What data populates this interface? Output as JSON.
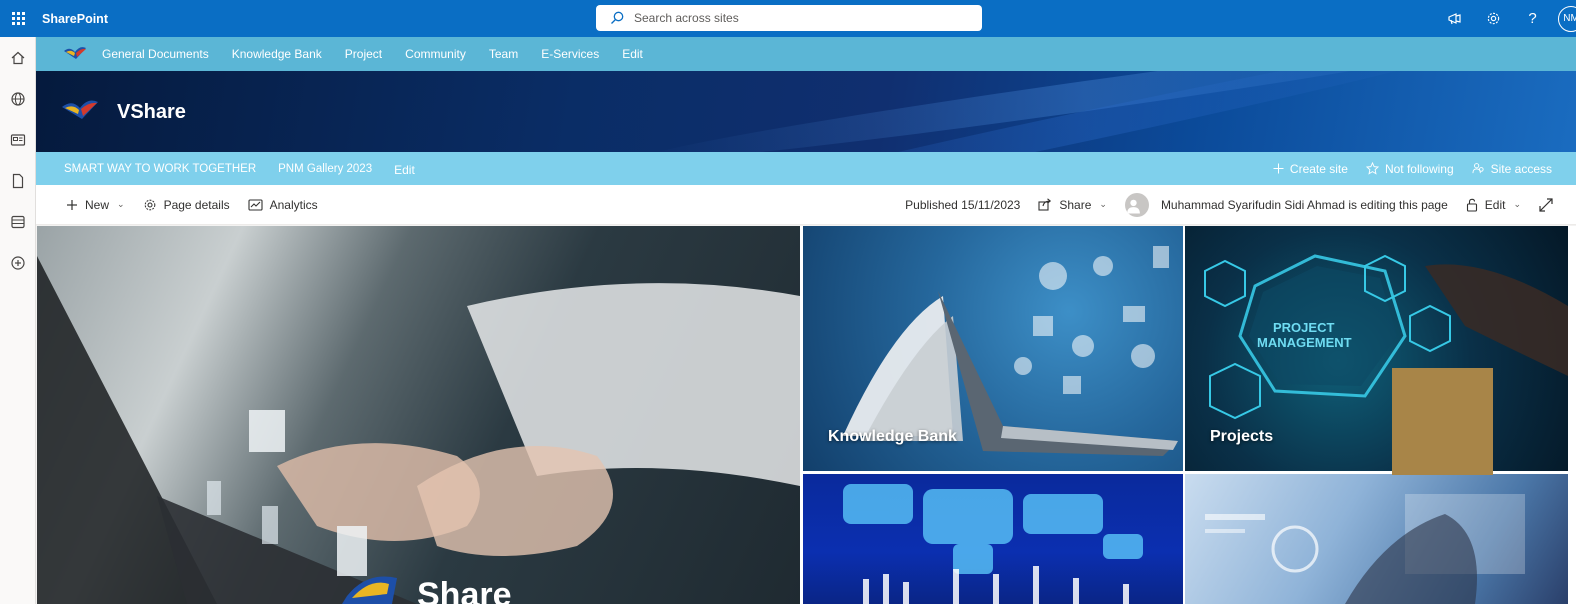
{
  "suite_bar": {
    "brand": "SharePoint",
    "search_placeholder": "Search across sites",
    "avatar_initials": "NM",
    "icons": [
      "waffle-icon",
      "megaphone-icon",
      "gear-icon",
      "help-icon"
    ],
    "accent_color": "#0a6ec4"
  },
  "app_bar": {
    "icons": [
      "home-icon",
      "globe-icon",
      "news-icon",
      "file-icon",
      "list-icon",
      "add-icon"
    ]
  },
  "hub_nav": {
    "links": [
      "General Documents",
      "Knowledge Bank",
      "Project",
      "Community",
      "Team",
      "E-Services",
      "Edit"
    ],
    "color": "#5bb6d6"
  },
  "site_header": {
    "title": "VShare"
  },
  "site_nav": {
    "links": [
      "SMART WAY TO WORK TOGETHER",
      "PNM Gallery 2023"
    ],
    "edit_label": "Edit",
    "create_site": "Create site",
    "not_following": "Not following",
    "site_access": "Site access",
    "color": "#7fd0ec"
  },
  "command_bar": {
    "new_label": "New",
    "page_details_label": "Page details",
    "analytics_label": "Analytics",
    "published": "Published 15/11/2023",
    "share_label": "Share",
    "editing_status": "Muhammad Syarifudin Sidi Ahmad is editing this page",
    "edit_label": "Edit"
  },
  "hero": {
    "main_title": "Share",
    "tiles": [
      {
        "label": "Knowledge Bank"
      },
      {
        "label": "Projects"
      },
      {
        "label": ""
      },
      {
        "label": ""
      }
    ],
    "project_overlay": "PROJECT MANAGEMENT"
  }
}
